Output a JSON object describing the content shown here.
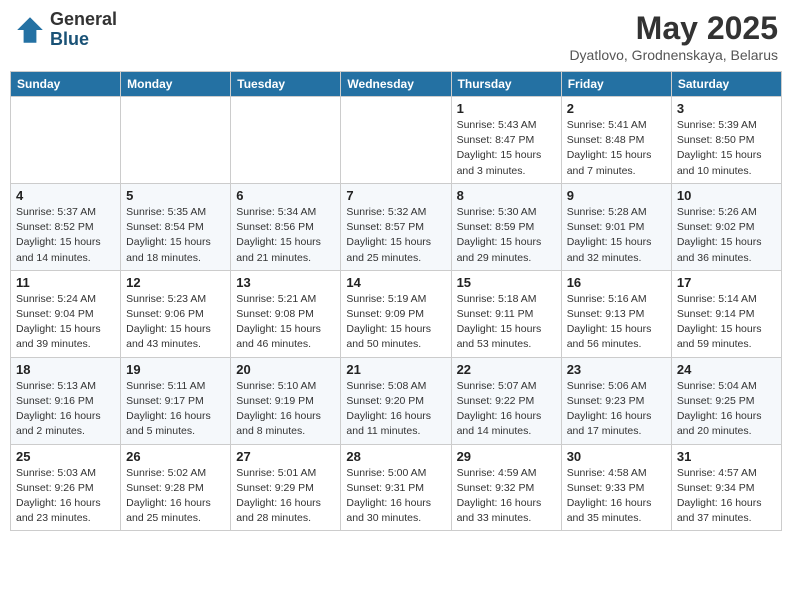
{
  "header": {
    "logo_general": "General",
    "logo_blue": "Blue",
    "month_title": "May 2025",
    "location": "Dyatlovo, Grodnenskaya, Belarus"
  },
  "weekdays": [
    "Sunday",
    "Monday",
    "Tuesday",
    "Wednesday",
    "Thursday",
    "Friday",
    "Saturday"
  ],
  "weeks": [
    [
      {
        "day": "",
        "detail": ""
      },
      {
        "day": "",
        "detail": ""
      },
      {
        "day": "",
        "detail": ""
      },
      {
        "day": "",
        "detail": ""
      },
      {
        "day": "1",
        "detail": "Sunrise: 5:43 AM\nSunset: 8:47 PM\nDaylight: 15 hours\nand 3 minutes."
      },
      {
        "day": "2",
        "detail": "Sunrise: 5:41 AM\nSunset: 8:48 PM\nDaylight: 15 hours\nand 7 minutes."
      },
      {
        "day": "3",
        "detail": "Sunrise: 5:39 AM\nSunset: 8:50 PM\nDaylight: 15 hours\nand 10 minutes."
      }
    ],
    [
      {
        "day": "4",
        "detail": "Sunrise: 5:37 AM\nSunset: 8:52 PM\nDaylight: 15 hours\nand 14 minutes."
      },
      {
        "day": "5",
        "detail": "Sunrise: 5:35 AM\nSunset: 8:54 PM\nDaylight: 15 hours\nand 18 minutes."
      },
      {
        "day": "6",
        "detail": "Sunrise: 5:34 AM\nSunset: 8:56 PM\nDaylight: 15 hours\nand 21 minutes."
      },
      {
        "day": "7",
        "detail": "Sunrise: 5:32 AM\nSunset: 8:57 PM\nDaylight: 15 hours\nand 25 minutes."
      },
      {
        "day": "8",
        "detail": "Sunrise: 5:30 AM\nSunset: 8:59 PM\nDaylight: 15 hours\nand 29 minutes."
      },
      {
        "day": "9",
        "detail": "Sunrise: 5:28 AM\nSunset: 9:01 PM\nDaylight: 15 hours\nand 32 minutes."
      },
      {
        "day": "10",
        "detail": "Sunrise: 5:26 AM\nSunset: 9:02 PM\nDaylight: 15 hours\nand 36 minutes."
      }
    ],
    [
      {
        "day": "11",
        "detail": "Sunrise: 5:24 AM\nSunset: 9:04 PM\nDaylight: 15 hours\nand 39 minutes."
      },
      {
        "day": "12",
        "detail": "Sunrise: 5:23 AM\nSunset: 9:06 PM\nDaylight: 15 hours\nand 43 minutes."
      },
      {
        "day": "13",
        "detail": "Sunrise: 5:21 AM\nSunset: 9:08 PM\nDaylight: 15 hours\nand 46 minutes."
      },
      {
        "day": "14",
        "detail": "Sunrise: 5:19 AM\nSunset: 9:09 PM\nDaylight: 15 hours\nand 50 minutes."
      },
      {
        "day": "15",
        "detail": "Sunrise: 5:18 AM\nSunset: 9:11 PM\nDaylight: 15 hours\nand 53 minutes."
      },
      {
        "day": "16",
        "detail": "Sunrise: 5:16 AM\nSunset: 9:13 PM\nDaylight: 15 hours\nand 56 minutes."
      },
      {
        "day": "17",
        "detail": "Sunrise: 5:14 AM\nSunset: 9:14 PM\nDaylight: 15 hours\nand 59 minutes."
      }
    ],
    [
      {
        "day": "18",
        "detail": "Sunrise: 5:13 AM\nSunset: 9:16 PM\nDaylight: 16 hours\nand 2 minutes."
      },
      {
        "day": "19",
        "detail": "Sunrise: 5:11 AM\nSunset: 9:17 PM\nDaylight: 16 hours\nand 5 minutes."
      },
      {
        "day": "20",
        "detail": "Sunrise: 5:10 AM\nSunset: 9:19 PM\nDaylight: 16 hours\nand 8 minutes."
      },
      {
        "day": "21",
        "detail": "Sunrise: 5:08 AM\nSunset: 9:20 PM\nDaylight: 16 hours\nand 11 minutes."
      },
      {
        "day": "22",
        "detail": "Sunrise: 5:07 AM\nSunset: 9:22 PM\nDaylight: 16 hours\nand 14 minutes."
      },
      {
        "day": "23",
        "detail": "Sunrise: 5:06 AM\nSunset: 9:23 PM\nDaylight: 16 hours\nand 17 minutes."
      },
      {
        "day": "24",
        "detail": "Sunrise: 5:04 AM\nSunset: 9:25 PM\nDaylight: 16 hours\nand 20 minutes."
      }
    ],
    [
      {
        "day": "25",
        "detail": "Sunrise: 5:03 AM\nSunset: 9:26 PM\nDaylight: 16 hours\nand 23 minutes."
      },
      {
        "day": "26",
        "detail": "Sunrise: 5:02 AM\nSunset: 9:28 PM\nDaylight: 16 hours\nand 25 minutes."
      },
      {
        "day": "27",
        "detail": "Sunrise: 5:01 AM\nSunset: 9:29 PM\nDaylight: 16 hours\nand 28 minutes."
      },
      {
        "day": "28",
        "detail": "Sunrise: 5:00 AM\nSunset: 9:31 PM\nDaylight: 16 hours\nand 30 minutes."
      },
      {
        "day": "29",
        "detail": "Sunrise: 4:59 AM\nSunset: 9:32 PM\nDaylight: 16 hours\nand 33 minutes."
      },
      {
        "day": "30",
        "detail": "Sunrise: 4:58 AM\nSunset: 9:33 PM\nDaylight: 16 hours\nand 35 minutes."
      },
      {
        "day": "31",
        "detail": "Sunrise: 4:57 AM\nSunset: 9:34 PM\nDaylight: 16 hours\nand 37 minutes."
      }
    ]
  ]
}
